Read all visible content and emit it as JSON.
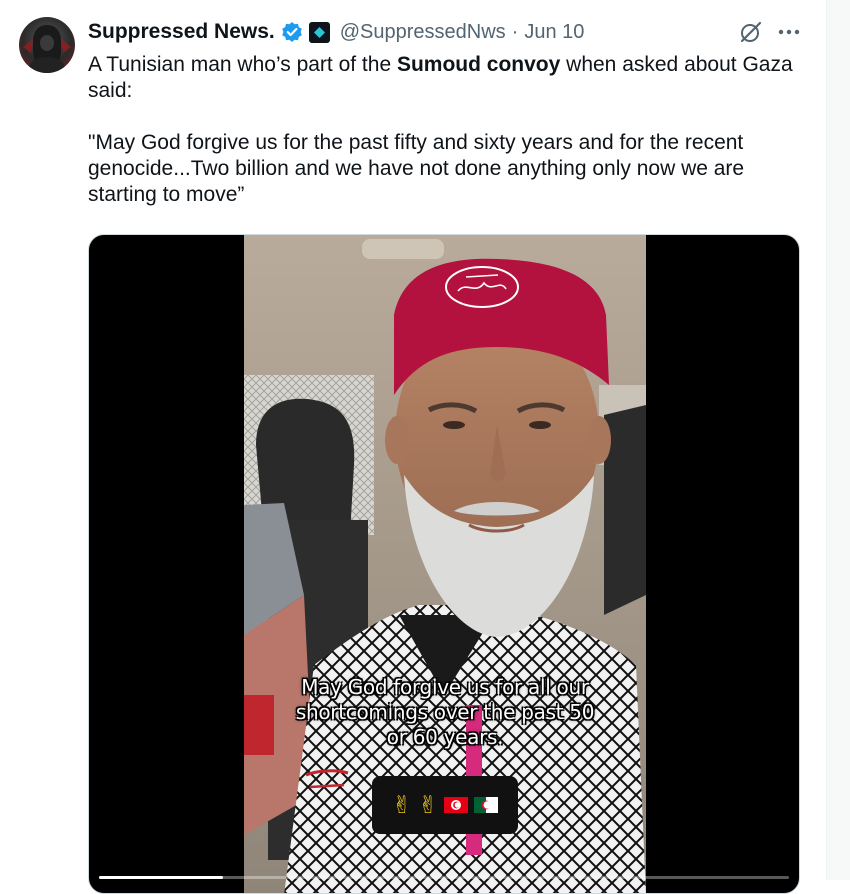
{
  "author": {
    "display_name": "Suppressed News.",
    "handle": "@SuppressedNws",
    "separator": "·",
    "date": "Jun 10"
  },
  "tweet": {
    "line1_prefix": "A Tunisian man who’s part of the ",
    "line1_bold": "Sumoud convoy",
    "line1_suffix": " when asked about Gaza said:",
    "quote": "\"May God forgive us for the past fifty and sixty years and for the recent genocide...Two billion and we have not done anything only now we are starting to move”"
  },
  "video": {
    "subtitle_line1": "May God forgive us for all our",
    "subtitle_line2": "shortcomings over the past 50",
    "subtitle_line3": "or 60 years.",
    "emoji_overlay": [
      "✌",
      "✌",
      "tunisia-flag",
      "algeria-flag"
    ],
    "cap_inscription": "arabic-calligraphy",
    "progress": 0.18
  },
  "icons": {
    "verified": "verified-badge-icon",
    "affiliate": "affiliate-badge-icon",
    "grok": "grok-icon",
    "more": "more-options-icon"
  },
  "colors": {
    "verified_blue": "#1d9bf0",
    "secondary_text": "#536471",
    "primary_text": "#0f1419",
    "cap_red": "#b3123e"
  }
}
